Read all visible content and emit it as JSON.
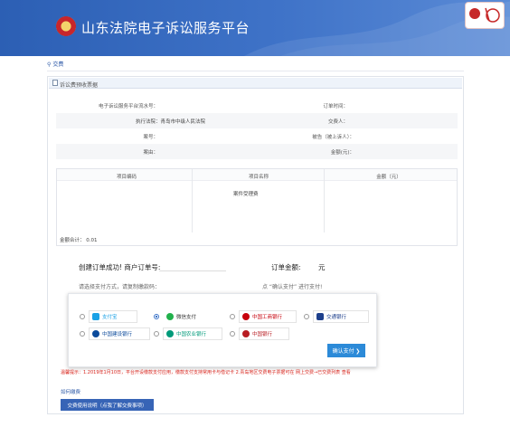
{
  "header": {
    "title": "山东法院电子诉讼服务平台"
  },
  "breadcrumb": {
    "label": "交费"
  },
  "panel": {
    "title": "诉讼费预收票据"
  },
  "info": {
    "service_no_label": "电子诉讼服务平台流水号：",
    "order_time_label": "订单时间：",
    "court_label": "执行法院：青岛市中级人民法院",
    "payer_label": "交费人：",
    "case_no_label": "案号：",
    "party_label": "被告（被上诉人）：",
    "cause_label": "案由：",
    "amount_label": "金额(元)："
  },
  "items": {
    "headers": [
      "项目编码",
      "项目名称",
      "金额（元）"
    ],
    "rows": [
      {
        "code": "",
        "name": "案件受理费",
        "amount": ""
      }
    ],
    "total": "金额合计：  0.01"
  },
  "order": {
    "created_label": "创建订单成功! 商户订单号:",
    "amount_label": "订单金额:",
    "unit": "元",
    "instruction": "请选择支付方式，请复制缴款码：",
    "instruction_2": "点 “确认支付” 进行支付!"
  },
  "payments": [
    {
      "label": "支付宝",
      "icon": "alipay-icon",
      "color": "#1aa1e6",
      "selected": false
    },
    {
      "label": "微信支付",
      "icon": "wechat-pay-icon",
      "color": "#22b14c",
      "selected": true
    },
    {
      "label": "中国工商银行",
      "icon": "icbc-icon",
      "color": "#c7000b",
      "selected": false
    },
    {
      "label": "交通银行",
      "icon": "bocom-icon",
      "color": "#1d3f8c",
      "selected": false
    },
    {
      "label": "中国建设银行",
      "icon": "ccb-icon",
      "color": "#0b4a9b",
      "selected": false
    },
    {
      "label": "中国农业银行",
      "icon": "abc-icon",
      "color": "#009a7a",
      "selected": false
    },
    {
      "label": "中国银行",
      "icon": "boc-icon",
      "color": "#b81c22",
      "selected": false
    }
  ],
  "confirm_button": "确认支付  ❯",
  "notice": "温馨提示：1.2019年1月10日，平台开设缴款支付应用，缴款支付支持常用卡与借记卡 2.青岛地区交费电子票据可在 网上交费→已交费列表 查看",
  "howto": "如何缴费",
  "guide_button": "交费使用说明（点我了解交费事项）",
  "colors": {
    "header": "#2c5fb4",
    "accent": "#2c8ad8",
    "warning": "#d9251d"
  }
}
